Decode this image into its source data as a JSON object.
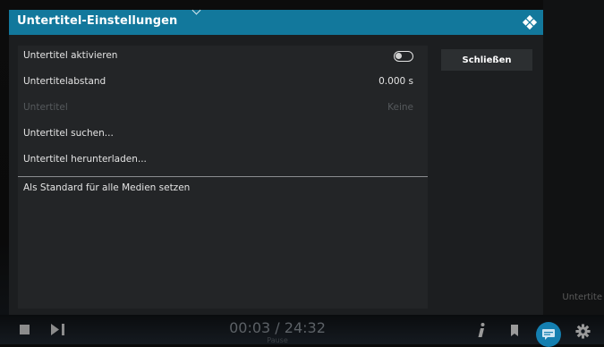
{
  "dialog": {
    "title": "Untertitel-Einstellungen",
    "close_label": "Schließen"
  },
  "settings": [
    {
      "label": "Untertitel aktivieren",
      "value": "",
      "control": "toggle",
      "state": "off",
      "enabled": true
    },
    {
      "label": "Untertitelabstand",
      "value": "0.000 s",
      "control": "value",
      "enabled": true
    },
    {
      "label": "Untertitel",
      "value": "Keine",
      "control": "value",
      "enabled": false
    },
    {
      "label": "Untertitel suchen...",
      "value": "",
      "control": "action",
      "enabled": true
    },
    {
      "label": "Untertitel herunterladen...",
      "value": "",
      "control": "action",
      "enabled": true
    },
    {
      "label": "Als Standard für alle Medien setzen",
      "value": "",
      "control": "action",
      "enabled": true
    }
  ],
  "background": {
    "subtitle_text": "Untertite"
  },
  "osd": {
    "time": "00:03 / 24:32",
    "state": "Pause",
    "icons": [
      "stop-icon",
      "next-icon",
      "info-icon",
      "bookmark-icon",
      "subtitles-icon",
      "settings-icon"
    ]
  },
  "colors": {
    "header": "#12789c",
    "dialog": "#1c1e20",
    "panel": "#232527",
    "accent": "#147fb0"
  }
}
